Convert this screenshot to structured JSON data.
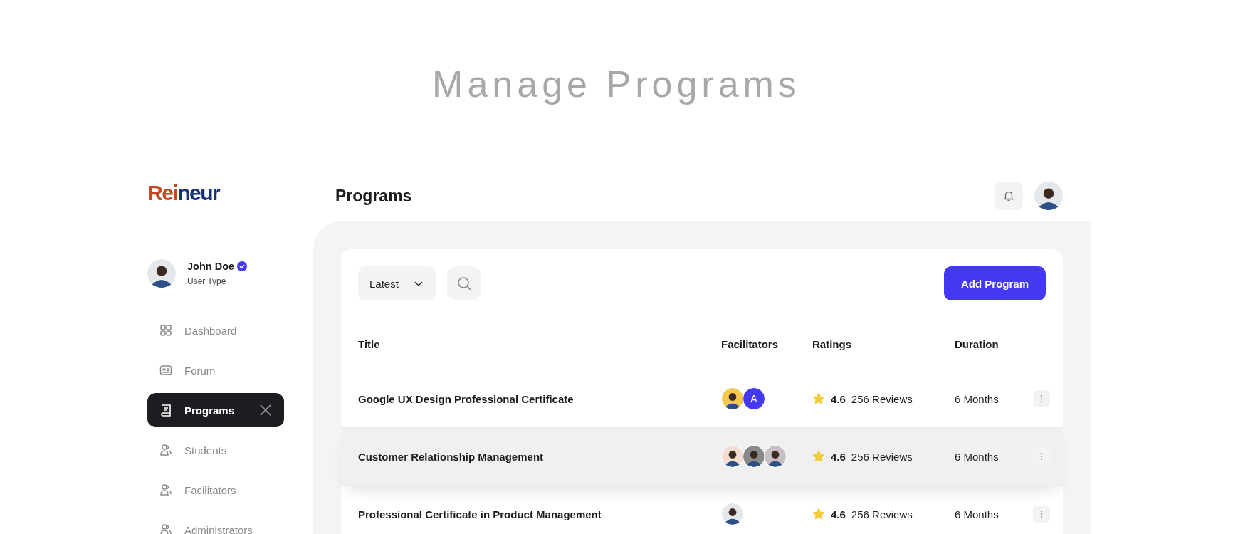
{
  "hero": {
    "title": "Manage Programs"
  },
  "logo": {
    "part_1": "Rei",
    "part_2": "neur"
  },
  "user": {
    "name": "John Doe",
    "verified": true,
    "role": "User Type"
  },
  "sidebar": {
    "items": [
      {
        "label": "Dashboard",
        "kind": "grid",
        "selected": false
      },
      {
        "label": "Forum",
        "kind": "forum",
        "selected": false
      },
      {
        "label": "Programs",
        "kind": "book",
        "selected": true
      },
      {
        "label": "Students",
        "kind": "users",
        "selected": false
      },
      {
        "label": "Facilitators",
        "kind": "users",
        "selected": false
      },
      {
        "label": "Administrators",
        "kind": "users",
        "selected": false
      }
    ]
  },
  "header": {
    "title": "Programs"
  },
  "toolbar": {
    "sort": "Latest",
    "add_button": "Add Program"
  },
  "table": {
    "columns": [
      "Title",
      "Facilitators",
      "Ratings",
      "Duration"
    ],
    "rows": [
      {
        "title": "Google UX Design Professional Certificate",
        "selected": false,
        "facilitators": [
          {
            "kind": "photo",
            "color": "#f2c94c"
          },
          {
            "kind": "initial",
            "text": "A",
            "color": "#4339f2"
          }
        ],
        "rating": "4.6",
        "reviews": "256 Reviews",
        "duration": "6 Months"
      },
      {
        "title": "Customer Relationship Management",
        "selected": true,
        "facilitators": [
          {
            "kind": "photo",
            "color": "#f3dcd0"
          },
          {
            "kind": "photo",
            "color": "#8a8a8a"
          },
          {
            "kind": "photo",
            "color": "#c7bfc4"
          }
        ],
        "rating": "4.6",
        "reviews": "256 Reviews",
        "duration": "6 Months"
      },
      {
        "title": "Professional Certificate in Product Management",
        "selected": false,
        "facilitators": [
          {
            "kind": "photo",
            "color": "#e4e8ea"
          }
        ],
        "rating": "4.6",
        "reviews": "256 Reviews",
        "duration": "6 Months"
      }
    ]
  }
}
